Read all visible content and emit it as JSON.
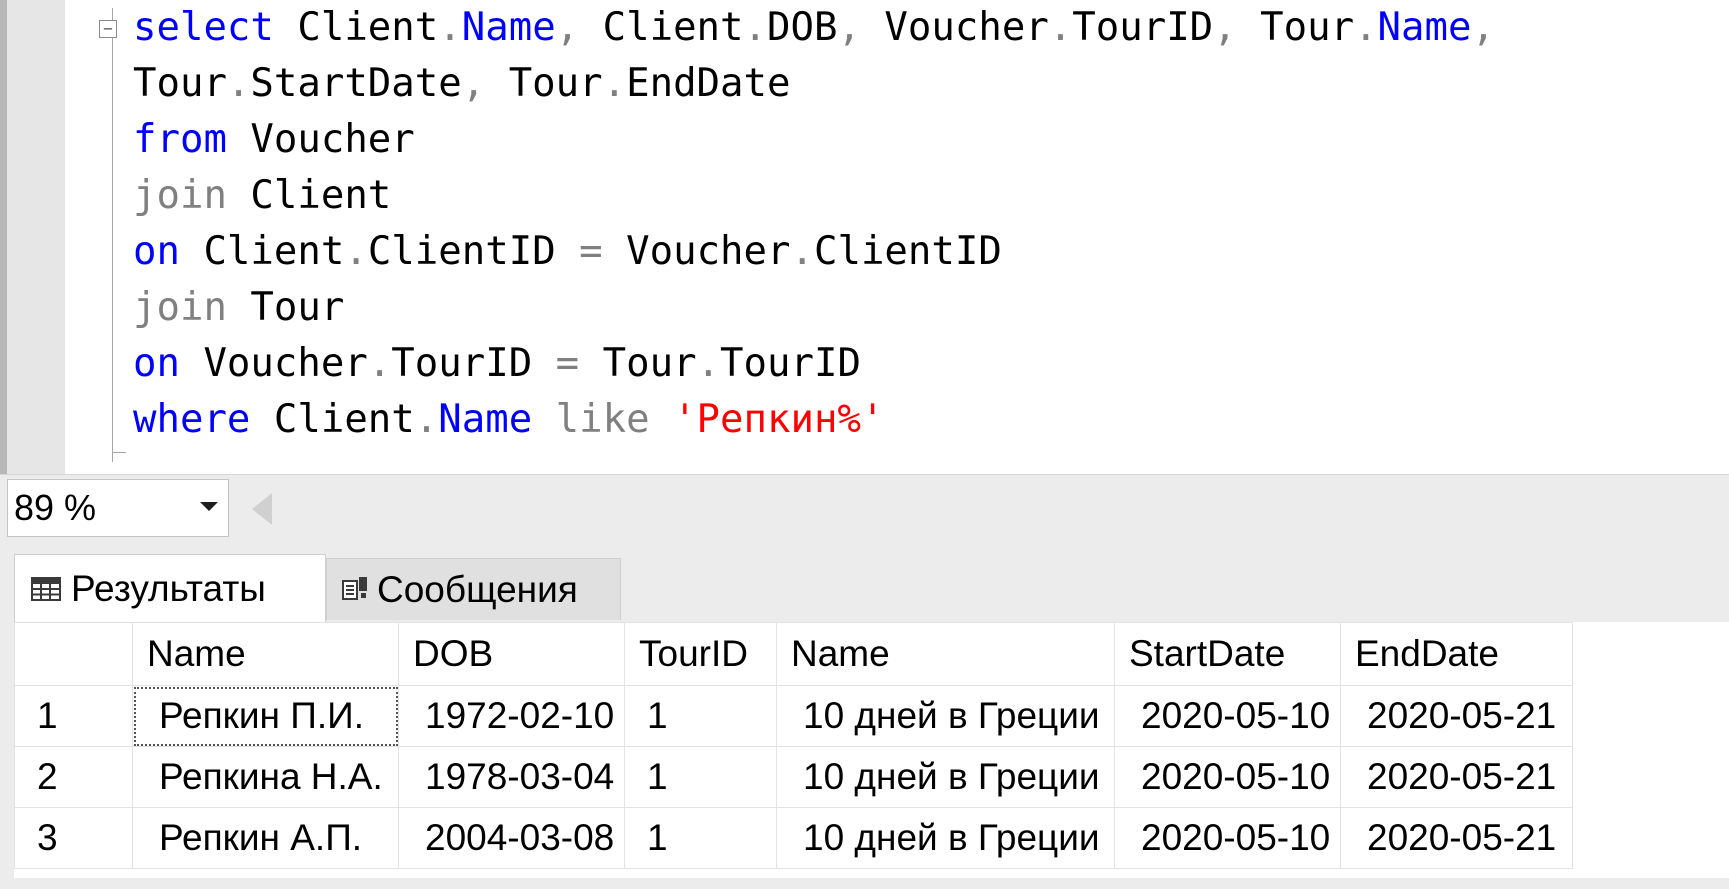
{
  "editor": {
    "lines": [
      [
        {
          "t": "select",
          "c": "kw"
        },
        {
          "t": " Client",
          "c": "id"
        },
        {
          "t": ".",
          "c": "op"
        },
        {
          "t": "Name",
          "c": "kw"
        },
        {
          "t": ",",
          "c": "op"
        },
        {
          "t": " Client",
          "c": "id"
        },
        {
          "t": ".",
          "c": "op"
        },
        {
          "t": "DOB",
          "c": "id"
        },
        {
          "t": ",",
          "c": "op"
        },
        {
          "t": " Voucher",
          "c": "id"
        },
        {
          "t": ".",
          "c": "op"
        },
        {
          "t": "TourID",
          "c": "id"
        },
        {
          "t": ",",
          "c": "op"
        },
        {
          "t": " Tour",
          "c": "id"
        },
        {
          "t": ".",
          "c": "op"
        },
        {
          "t": "Name",
          "c": "kw"
        },
        {
          "t": ",",
          "c": "op"
        }
      ],
      [
        {
          "t": "Tour",
          "c": "id"
        },
        {
          "t": ".",
          "c": "op"
        },
        {
          "t": "StartDate",
          "c": "id"
        },
        {
          "t": ",",
          "c": "op"
        },
        {
          "t": " Tour",
          "c": "id"
        },
        {
          "t": ".",
          "c": "op"
        },
        {
          "t": "EndDate",
          "c": "id"
        }
      ],
      [
        {
          "t": "from",
          "c": "kw"
        },
        {
          "t": " Voucher",
          "c": "id"
        }
      ],
      [
        {
          "t": "join",
          "c": "op"
        },
        {
          "t": " Client",
          "c": "id"
        }
      ],
      [
        {
          "t": "on",
          "c": "kw"
        },
        {
          "t": " Client",
          "c": "id"
        },
        {
          "t": ".",
          "c": "op"
        },
        {
          "t": "ClientID",
          "c": "id"
        },
        {
          "t": " = ",
          "c": "op"
        },
        {
          "t": "Voucher",
          "c": "id"
        },
        {
          "t": ".",
          "c": "op"
        },
        {
          "t": "ClientID",
          "c": "id"
        }
      ],
      [
        {
          "t": "join",
          "c": "op"
        },
        {
          "t": " Tour",
          "c": "id"
        }
      ],
      [
        {
          "t": "on",
          "c": "kw"
        },
        {
          "t": " Voucher",
          "c": "id"
        },
        {
          "t": ".",
          "c": "op"
        },
        {
          "t": "TourID",
          "c": "id"
        },
        {
          "t": " = ",
          "c": "op"
        },
        {
          "t": "Tour",
          "c": "id"
        },
        {
          "t": ".",
          "c": "op"
        },
        {
          "t": "TourID",
          "c": "id"
        }
      ],
      [
        {
          "t": "where",
          "c": "kw"
        },
        {
          "t": " Client",
          "c": "id"
        },
        {
          "t": ".",
          "c": "op"
        },
        {
          "t": "Name",
          "c": "kw"
        },
        {
          "t": " like ",
          "c": "op"
        },
        {
          "t": "'Репкин%'",
          "c": "str"
        }
      ]
    ]
  },
  "zoom": {
    "value": "89 %"
  },
  "tabs": {
    "results_label": "Результаты",
    "results_icon": "grid-icon",
    "messages_label": "Сообщения",
    "messages_icon": "messages-icon"
  },
  "grid": {
    "columns": [
      "",
      "Name",
      "DOB",
      "TourID",
      "Name",
      "StartDate",
      "EndDate"
    ],
    "rows": [
      [
        "1",
        "Репкин П.И.",
        "1972-02-10",
        "1",
        "10 дней в Греции",
        "2020-05-10",
        "2020-05-21"
      ],
      [
        "2",
        "Репкина Н.А.",
        "1978-03-04",
        "1",
        "10 дней в Греции",
        "2020-05-10",
        "2020-05-21"
      ],
      [
        "3",
        "Репкин А.П.",
        "2004-03-08",
        "1",
        "10 дней в Греции",
        "2020-05-10",
        "2020-05-21"
      ]
    ]
  },
  "colors": {
    "keyword": "#0000ff",
    "operator": "#808080",
    "string": "#ff0000"
  }
}
